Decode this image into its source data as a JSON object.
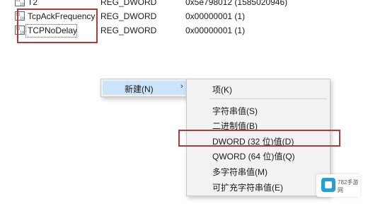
{
  "registry": {
    "rows": [
      {
        "name": "T2",
        "type": "REG_DWORD",
        "data": "0x5e798012 (1585020946)"
      },
      {
        "name": "TcpAckFrequency",
        "type": "REG_DWORD",
        "data": "0x00000001 (1)"
      },
      {
        "name": "TCPNoDelay",
        "type": "REG_DWORD",
        "data": "0x00000001 (1)"
      }
    ],
    "icon": "reg-binary-value-icon"
  },
  "context_menu": {
    "new_label": "新建(N)",
    "arrow": "›",
    "submenu": [
      {
        "label": "项(K)"
      },
      {
        "label": "字符串值(S)"
      },
      {
        "label": "二进制值(B)"
      },
      {
        "label": "DWORD (32 位)值(D)"
      },
      {
        "label": "QWORD (64 位)值(Q)"
      },
      {
        "label": "多字符串值(M)"
      },
      {
        "label": "可扩充字符串值(E)"
      }
    ]
  },
  "watermark": {
    "text": "782手游网",
    "icon": "site-logo-icon"
  },
  "colors": {
    "highlight_border": "#b03a3a",
    "menu_hover": "#cce4f7",
    "menu_bg": "#f2f2f2"
  }
}
